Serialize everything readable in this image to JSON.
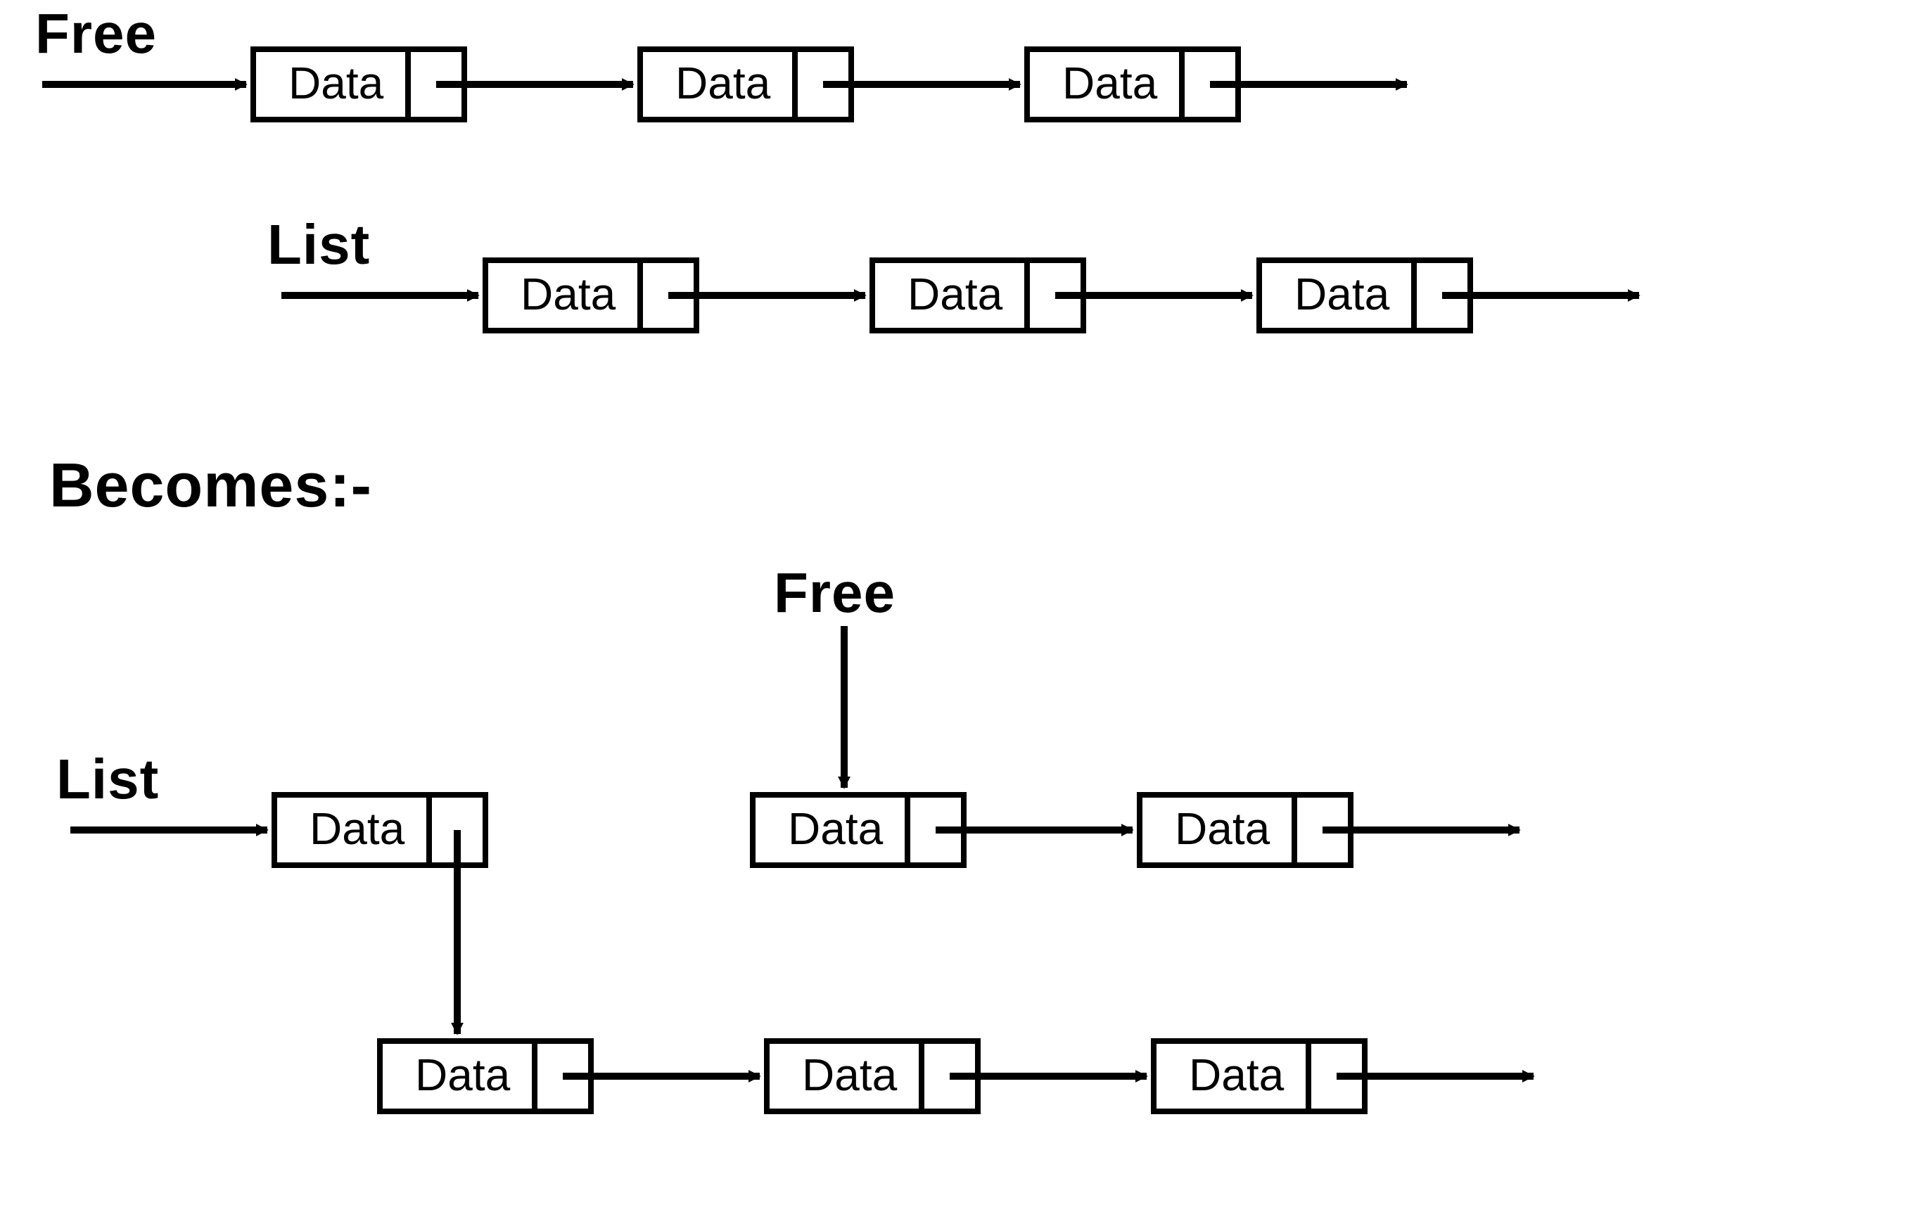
{
  "labels": {
    "free": "Free",
    "list": "List",
    "becomes": "Becomes:-",
    "data": "Data"
  },
  "diagram": {
    "before": {
      "free_list_nodes": 3,
      "list_nodes": 3
    },
    "after": {
      "free_list_nodes": 2,
      "list_head_nodes": 1,
      "list_tail_nodes": 3
    },
    "description": "Linked-list node removal: the first node of Free is spliced out of Free and the List head's next pointer is redirected to a new chain."
  }
}
